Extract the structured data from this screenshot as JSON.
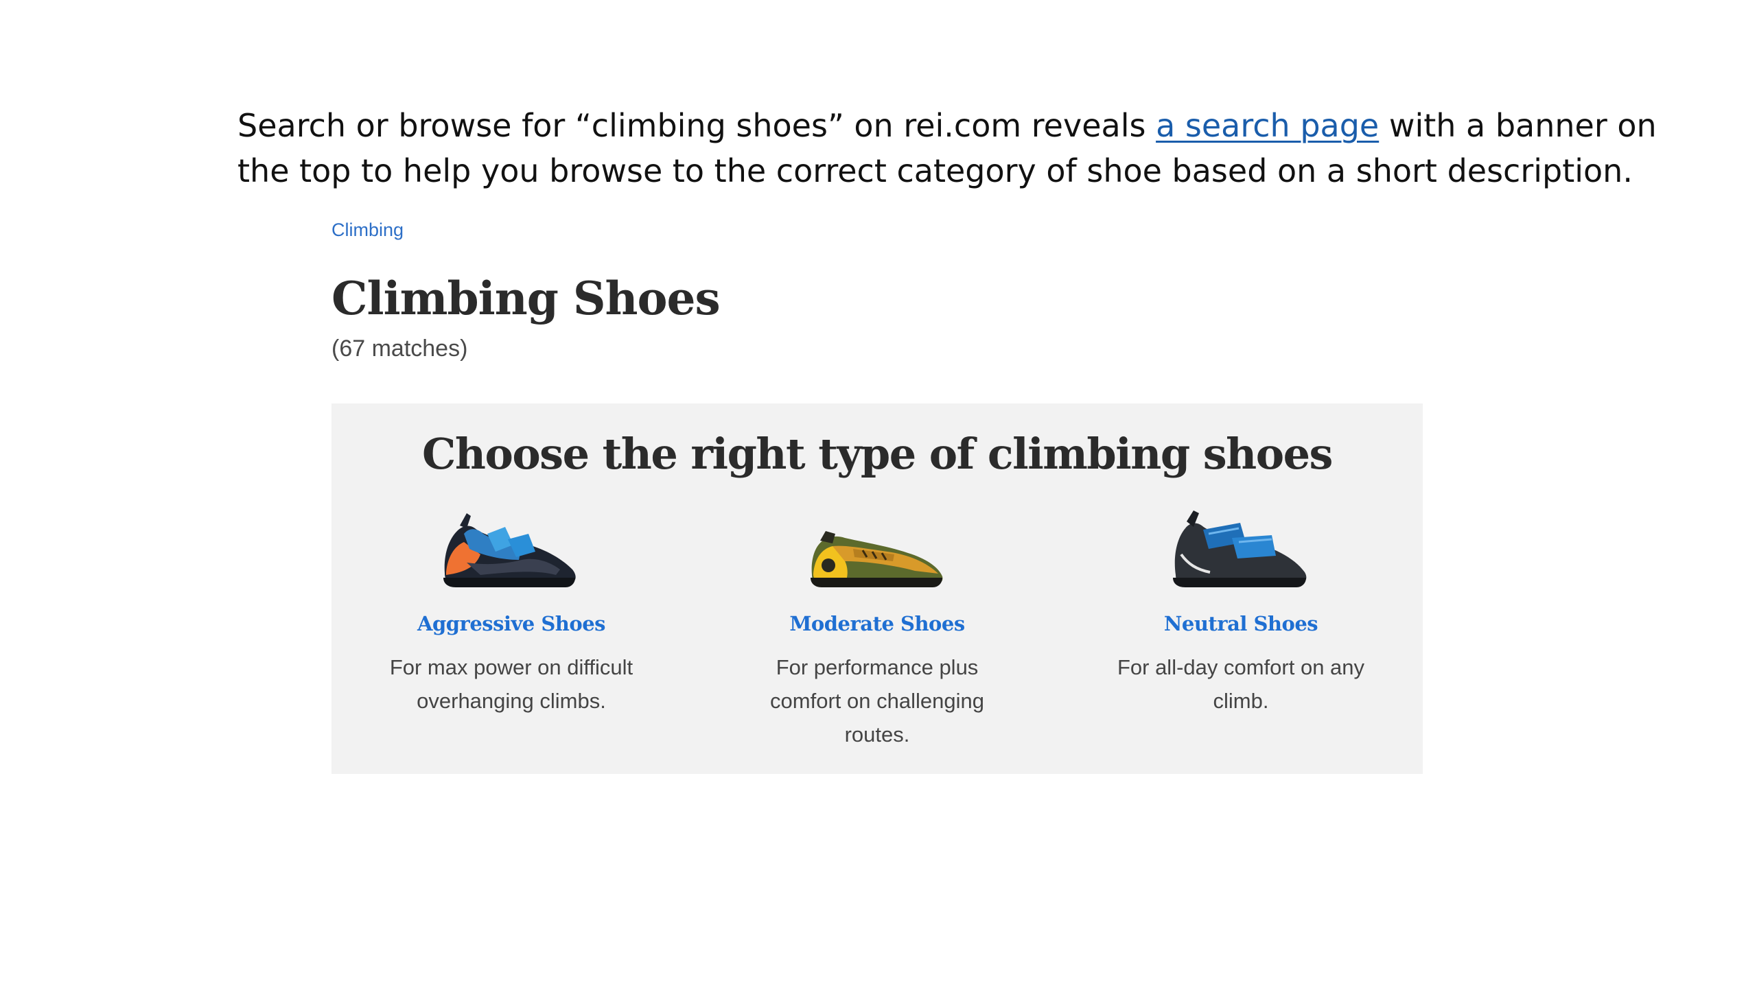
{
  "intro": {
    "part1": "Search or browse for “climbing shoes” on rei.com reveals ",
    "link": "a search page",
    "part2": " with a banner on",
    "line2": "the top to help you browse to the correct category of shoe based on a short description."
  },
  "page": {
    "breadcrumb": "Climbing",
    "title": "Climbing Shoes",
    "match_count": "(67 matches)"
  },
  "banner": {
    "title": "Choose the right type of climbing shoes",
    "cards": [
      {
        "label": "Aggressive Shoes",
        "description": "For max power on difficult overhanging climbs.",
        "icon": "aggressive-shoe-image"
      },
      {
        "label": "Moderate Shoes",
        "description": "For performance plus comfort on challenging routes.",
        "icon": "moderate-shoe-image"
      },
      {
        "label": "Neutral Shoes",
        "description": "For all-day comfort on any climb.",
        "icon": "neutral-shoe-image"
      }
    ]
  },
  "colors": {
    "link": "#1f6fd2",
    "intro_link": "#1a5dab",
    "banner_bg": "#f2f2f2",
    "title": "#2b2b2b"
  }
}
